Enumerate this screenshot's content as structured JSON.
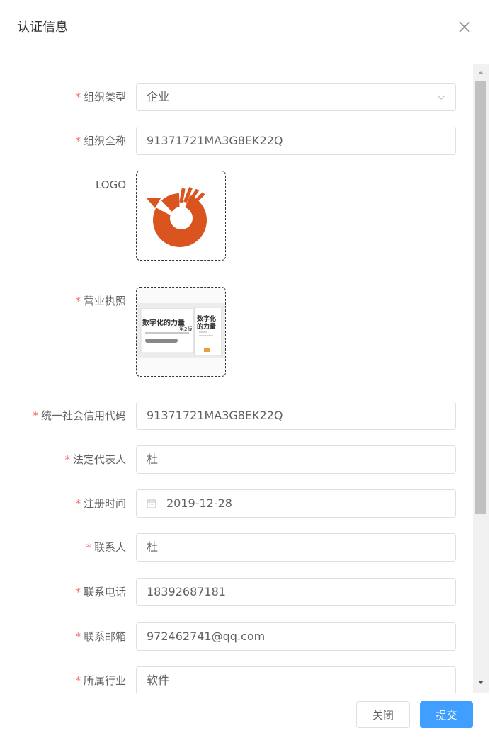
{
  "dialog": {
    "title": "认证信息"
  },
  "form": {
    "required_mark": "*",
    "org_type": {
      "label": "组织类型",
      "value": "企业"
    },
    "org_name": {
      "label": "组织全称",
      "value": "91371721MA3G8EK22Q"
    },
    "logo": {
      "label": "LOGO"
    },
    "license": {
      "label": "营业执照",
      "book_title": "数字化的力量",
      "book_edition": "第2版",
      "book_spine": "数字化的力量"
    },
    "credit_code": {
      "label": "统一社会信用代码",
      "value": "91371721MA3G8EK22Q"
    },
    "legal_rep": {
      "label": "法定代表人",
      "value": "杜"
    },
    "reg_date": {
      "label": "注册时间",
      "value": "2019-12-28"
    },
    "contact": {
      "label": "联系人",
      "value": "杜"
    },
    "phone": {
      "label": "联系电话",
      "value": "18392687181"
    },
    "email": {
      "label": "联系邮箱",
      "value": "972462741@qq.com"
    },
    "industry": {
      "label": "所属行业",
      "value": "软件"
    }
  },
  "footer": {
    "close_label": "关闭",
    "submit_label": "提交"
  },
  "colors": {
    "required": "#f56c6c",
    "primary": "#409eff",
    "logo": "#d9541f"
  }
}
